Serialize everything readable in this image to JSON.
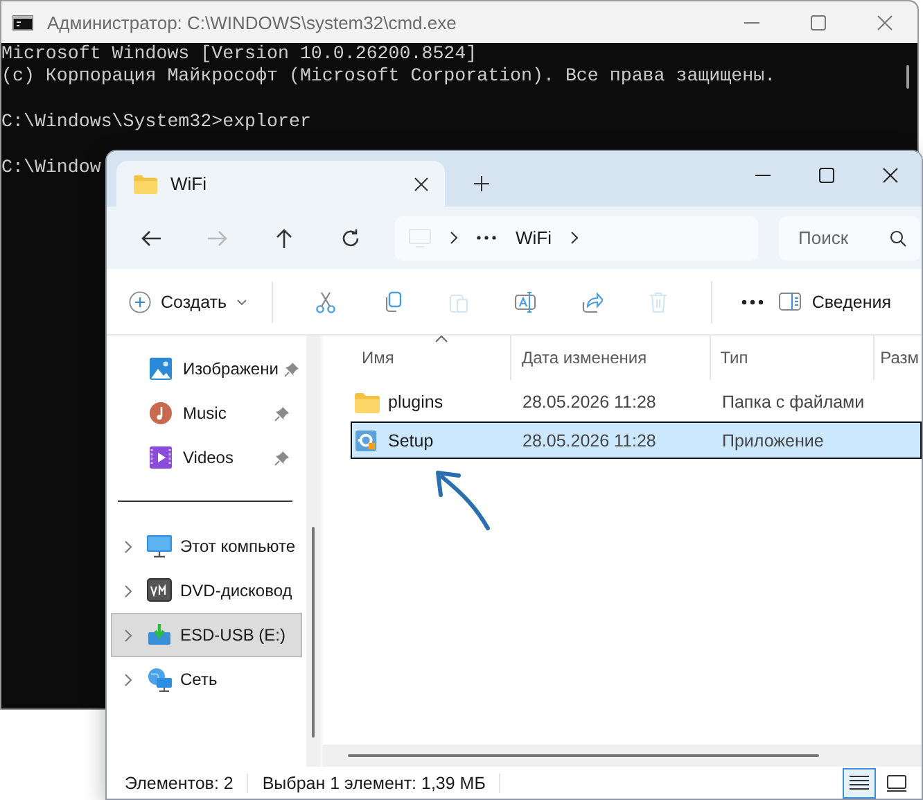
{
  "console_window": {
    "title": "Администратор: C:\\WINDOWS\\system32\\cmd.exe",
    "lines": [
      {
        "text": "Microsoft Windows [Version 10.0.26200.8524]",
        "gap_after": false
      },
      {
        "text": "(c) Корпорация Майкрософт (Microsoft Corporation). Все права защищены.",
        "gap_after": true
      },
      {
        "text": "C:\\Windows\\System32>explorer",
        "gap_after": true
      },
      {
        "text": "C:\\Window",
        "gap_after": false
      }
    ]
  },
  "explorer_window": {
    "tabs": [
      {
        "label": "WiFi",
        "selected": true
      }
    ],
    "nav_buttons": [
      {
        "kind": "back",
        "disabled": false
      },
      {
        "kind": "forward",
        "disabled": true
      },
      {
        "kind": "up",
        "disabled": false
      },
      {
        "kind": "refresh",
        "disabled": false
      }
    ],
    "address_bar": {
      "segments": [
        "WiFi"
      ]
    },
    "search": {
      "placeholder": "Поиск"
    },
    "toolbar": {
      "new_button": "Создать",
      "actions": [
        {
          "kind": "cut",
          "disabled": false
        },
        {
          "kind": "copy",
          "disabled": false
        },
        {
          "kind": "paste",
          "disabled": true
        },
        {
          "kind": "rename",
          "disabled": false
        },
        {
          "kind": "share",
          "disabled": false
        },
        {
          "kind": "delete",
          "disabled": true
        }
      ],
      "details_button": "Сведения"
    },
    "sidebar": {
      "quick_access": [
        {
          "label": "Изображени",
          "kind": "pictures",
          "pinned": true
        },
        {
          "label": "Music",
          "kind": "music",
          "pinned": true
        },
        {
          "label": "Videos",
          "kind": "videos",
          "pinned": true
        }
      ],
      "locations": [
        {
          "label": "Этот компьюте",
          "kind": "pc",
          "selected": false
        },
        {
          "label": "DVD-дисковод",
          "kind": "dvd",
          "selected": false
        },
        {
          "label": "ESD-USB (E:)",
          "kind": "usb",
          "selected": true
        },
        {
          "label": "Сеть",
          "kind": "network",
          "selected": false
        }
      ]
    },
    "file_list": {
      "columns": [
        {
          "label": "Имя",
          "sorted": true
        },
        {
          "label": "Дата изменения",
          "sorted": false
        },
        {
          "label": "Тип",
          "sorted": false
        },
        {
          "label": "Разм",
          "sorted": false
        }
      ],
      "rows": [
        {
          "name": "plugins",
          "kind": "folder",
          "modified": "28.05.2026 11:28",
          "type": "Папка с файлами",
          "selected": false
        },
        {
          "name": "Setup",
          "kind": "app",
          "modified": "28.05.2026 11:28",
          "type": "Приложение",
          "selected": true
        }
      ]
    },
    "status_bar": {
      "item_count": "Элементов: 2",
      "selection": "Выбран 1 элемент: 1,39 МБ",
      "views": [
        {
          "kind": "details",
          "selected": true
        },
        {
          "kind": "tiles",
          "selected": false
        }
      ]
    }
  }
}
